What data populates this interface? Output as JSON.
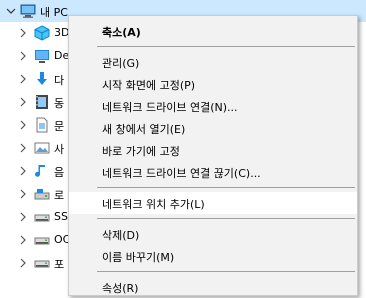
{
  "nav_pane": {
    "root": {
      "label": "내 PC",
      "icon": "this-pc-icon"
    },
    "items": [
      {
        "label": "3D",
        "icon": "3d-objects-icon"
      },
      {
        "label": "De",
        "icon": "desktop-icon"
      },
      {
        "label": "다",
        "icon": "downloads-icon"
      },
      {
        "label": "동",
        "icon": "videos-icon"
      },
      {
        "label": "문",
        "icon": "documents-icon"
      },
      {
        "label": "사",
        "icon": "pictures-icon"
      },
      {
        "label": "음",
        "icon": "music-icon"
      },
      {
        "label": "로",
        "icon": "local-disk-icon"
      },
      {
        "label": "SS",
        "icon": "drive-icon"
      },
      {
        "label": "OC",
        "icon": "drive-icon"
      },
      {
        "label": "포",
        "icon": "drive-icon"
      }
    ]
  },
  "context_menu": {
    "items": [
      {
        "label": "축소(A)",
        "bold": true
      },
      {
        "separator": true
      },
      {
        "label": "관리(G)"
      },
      {
        "label": "시작 화면에 고정(P)"
      },
      {
        "label": "네트워크 드라이브 연결(N)..."
      },
      {
        "label": "새 창에서 열기(E)"
      },
      {
        "label": "바로 가기에 고정"
      },
      {
        "label": "네트워크 드라이브 연결 끊기(C)..."
      },
      {
        "separator": true
      },
      {
        "label": "네트워크 위치 추가(L)",
        "hovered": true
      },
      {
        "separator": true
      },
      {
        "label": "삭제(D)"
      },
      {
        "label": "이름 바꾸기(M)"
      },
      {
        "separator": true
      },
      {
        "label": "속성(R)"
      }
    ]
  },
  "colors": {
    "selection": "#cce8ff",
    "menu_background": "#f2f2f2",
    "menu_hover": "#ffffff",
    "separator": "#a0a0a0"
  }
}
